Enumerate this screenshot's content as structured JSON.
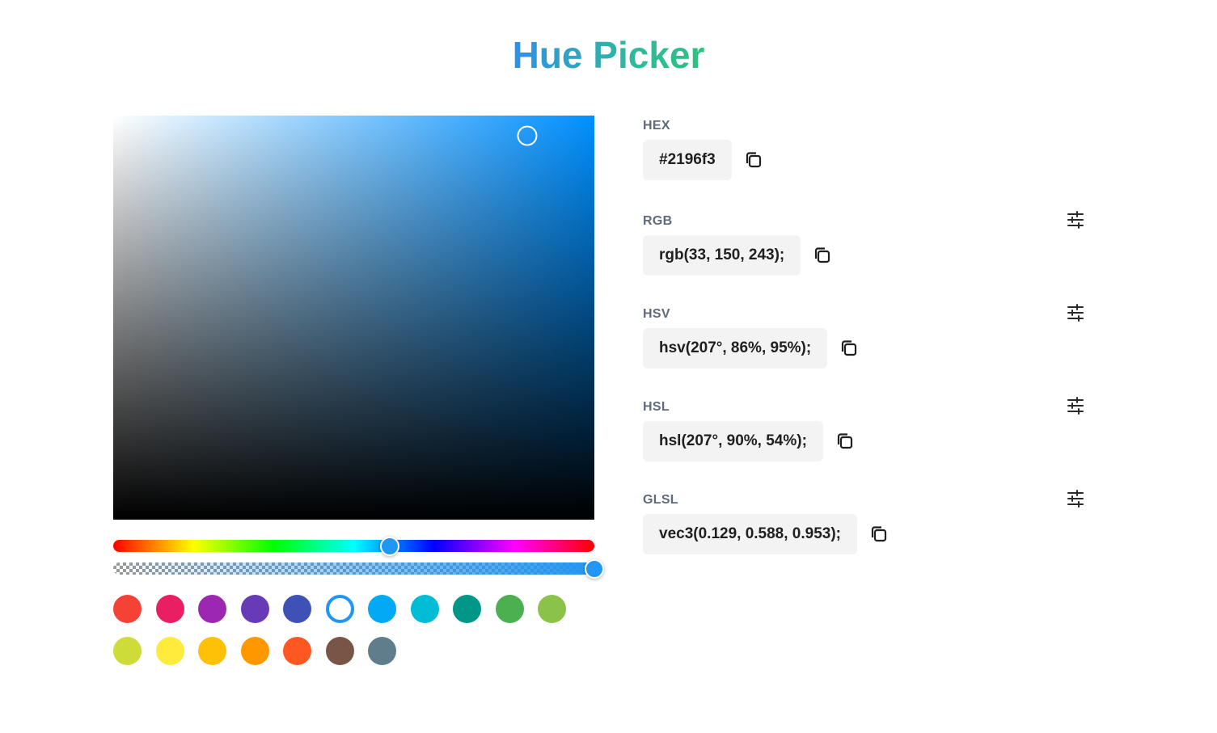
{
  "title": "Hue Picker",
  "current_color": "#2196f3",
  "picker": {
    "hue_degrees": 207,
    "saturation_percent": 86,
    "value_percent": 95,
    "alpha": 1.0,
    "sv_plane_color": "#0090ff"
  },
  "formats": [
    {
      "id": "hex",
      "label": "HEX",
      "value": "#2196f3",
      "has_settings": false,
      "copy_icon": "copy-icon"
    },
    {
      "id": "rgb",
      "label": "RGB",
      "value": "rgb(33, 150, 243);",
      "has_settings": true,
      "copy_icon": "copy-icon",
      "settings_icon": "tune-icon"
    },
    {
      "id": "hsv",
      "label": "HSV",
      "value": "hsv(207°, 86%, 95%);",
      "has_settings": true,
      "copy_icon": "copy-icon",
      "settings_icon": "tune-icon"
    },
    {
      "id": "hsl",
      "label": "HSL",
      "value": "hsl(207°, 90%, 54%);",
      "has_settings": true,
      "copy_icon": "copy-icon",
      "settings_icon": "tune-icon"
    },
    {
      "id": "glsl",
      "label": "GLSL",
      "value": "vec3(0.129, 0.588, 0.953);",
      "has_settings": true,
      "copy_icon": "copy-icon",
      "settings_icon": "tune-icon"
    }
  ],
  "swatches": [
    {
      "color": "#f44336",
      "selected": false
    },
    {
      "color": "#e91e63",
      "selected": false
    },
    {
      "color": "#9c27b0",
      "selected": false
    },
    {
      "color": "#673ab7",
      "selected": false
    },
    {
      "color": "#3f51b5",
      "selected": false
    },
    {
      "color": "#2196f3",
      "selected": true
    },
    {
      "color": "#03a9f4",
      "selected": false
    },
    {
      "color": "#00bcd4",
      "selected": false
    },
    {
      "color": "#009688",
      "selected": false
    },
    {
      "color": "#4caf50",
      "selected": false
    },
    {
      "color": "#8bc34a",
      "selected": false
    },
    {
      "color": "#cddc39",
      "selected": false
    },
    {
      "color": "#ffeb3b",
      "selected": false
    },
    {
      "color": "#ffc107",
      "selected": false
    },
    {
      "color": "#ff9800",
      "selected": false
    },
    {
      "color": "#ff5722",
      "selected": false
    },
    {
      "color": "#795548",
      "selected": false
    },
    {
      "color": "#607d8b",
      "selected": false
    }
  ]
}
